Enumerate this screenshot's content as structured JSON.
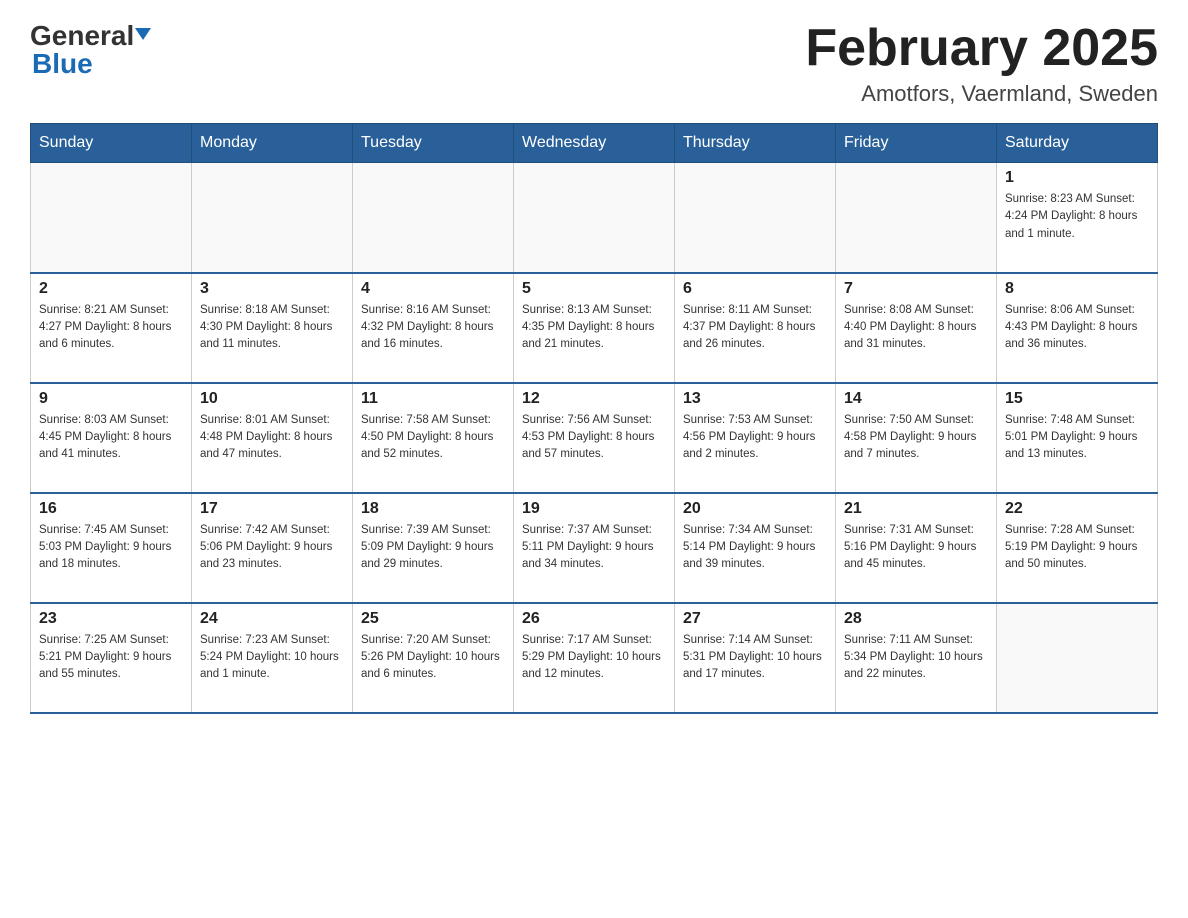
{
  "header": {
    "month_title": "February 2025",
    "location": "Amotfors, Vaermland, Sweden",
    "logo_general": "General",
    "logo_blue": "Blue"
  },
  "days_of_week": [
    "Sunday",
    "Monday",
    "Tuesday",
    "Wednesday",
    "Thursday",
    "Friday",
    "Saturday"
  ],
  "weeks": [
    {
      "days": [
        {
          "number": "",
          "info": ""
        },
        {
          "number": "",
          "info": ""
        },
        {
          "number": "",
          "info": ""
        },
        {
          "number": "",
          "info": ""
        },
        {
          "number": "",
          "info": ""
        },
        {
          "number": "",
          "info": ""
        },
        {
          "number": "1",
          "info": "Sunrise: 8:23 AM\nSunset: 4:24 PM\nDaylight: 8 hours and 1 minute."
        }
      ]
    },
    {
      "days": [
        {
          "number": "2",
          "info": "Sunrise: 8:21 AM\nSunset: 4:27 PM\nDaylight: 8 hours and 6 minutes."
        },
        {
          "number": "3",
          "info": "Sunrise: 8:18 AM\nSunset: 4:30 PM\nDaylight: 8 hours and 11 minutes."
        },
        {
          "number": "4",
          "info": "Sunrise: 8:16 AM\nSunset: 4:32 PM\nDaylight: 8 hours and 16 minutes."
        },
        {
          "number": "5",
          "info": "Sunrise: 8:13 AM\nSunset: 4:35 PM\nDaylight: 8 hours and 21 minutes."
        },
        {
          "number": "6",
          "info": "Sunrise: 8:11 AM\nSunset: 4:37 PM\nDaylight: 8 hours and 26 minutes."
        },
        {
          "number": "7",
          "info": "Sunrise: 8:08 AM\nSunset: 4:40 PM\nDaylight: 8 hours and 31 minutes."
        },
        {
          "number": "8",
          "info": "Sunrise: 8:06 AM\nSunset: 4:43 PM\nDaylight: 8 hours and 36 minutes."
        }
      ]
    },
    {
      "days": [
        {
          "number": "9",
          "info": "Sunrise: 8:03 AM\nSunset: 4:45 PM\nDaylight: 8 hours and 41 minutes."
        },
        {
          "number": "10",
          "info": "Sunrise: 8:01 AM\nSunset: 4:48 PM\nDaylight: 8 hours and 47 minutes."
        },
        {
          "number": "11",
          "info": "Sunrise: 7:58 AM\nSunset: 4:50 PM\nDaylight: 8 hours and 52 minutes."
        },
        {
          "number": "12",
          "info": "Sunrise: 7:56 AM\nSunset: 4:53 PM\nDaylight: 8 hours and 57 minutes."
        },
        {
          "number": "13",
          "info": "Sunrise: 7:53 AM\nSunset: 4:56 PM\nDaylight: 9 hours and 2 minutes."
        },
        {
          "number": "14",
          "info": "Sunrise: 7:50 AM\nSunset: 4:58 PM\nDaylight: 9 hours and 7 minutes."
        },
        {
          "number": "15",
          "info": "Sunrise: 7:48 AM\nSunset: 5:01 PM\nDaylight: 9 hours and 13 minutes."
        }
      ]
    },
    {
      "days": [
        {
          "number": "16",
          "info": "Sunrise: 7:45 AM\nSunset: 5:03 PM\nDaylight: 9 hours and 18 minutes."
        },
        {
          "number": "17",
          "info": "Sunrise: 7:42 AM\nSunset: 5:06 PM\nDaylight: 9 hours and 23 minutes."
        },
        {
          "number": "18",
          "info": "Sunrise: 7:39 AM\nSunset: 5:09 PM\nDaylight: 9 hours and 29 minutes."
        },
        {
          "number": "19",
          "info": "Sunrise: 7:37 AM\nSunset: 5:11 PM\nDaylight: 9 hours and 34 minutes."
        },
        {
          "number": "20",
          "info": "Sunrise: 7:34 AM\nSunset: 5:14 PM\nDaylight: 9 hours and 39 minutes."
        },
        {
          "number": "21",
          "info": "Sunrise: 7:31 AM\nSunset: 5:16 PM\nDaylight: 9 hours and 45 minutes."
        },
        {
          "number": "22",
          "info": "Sunrise: 7:28 AM\nSunset: 5:19 PM\nDaylight: 9 hours and 50 minutes."
        }
      ]
    },
    {
      "days": [
        {
          "number": "23",
          "info": "Sunrise: 7:25 AM\nSunset: 5:21 PM\nDaylight: 9 hours and 55 minutes."
        },
        {
          "number": "24",
          "info": "Sunrise: 7:23 AM\nSunset: 5:24 PM\nDaylight: 10 hours and 1 minute."
        },
        {
          "number": "25",
          "info": "Sunrise: 7:20 AM\nSunset: 5:26 PM\nDaylight: 10 hours and 6 minutes."
        },
        {
          "number": "26",
          "info": "Sunrise: 7:17 AM\nSunset: 5:29 PM\nDaylight: 10 hours and 12 minutes."
        },
        {
          "number": "27",
          "info": "Sunrise: 7:14 AM\nSunset: 5:31 PM\nDaylight: 10 hours and 17 minutes."
        },
        {
          "number": "28",
          "info": "Sunrise: 7:11 AM\nSunset: 5:34 PM\nDaylight: 10 hours and 22 minutes."
        },
        {
          "number": "",
          "info": ""
        }
      ]
    }
  ]
}
